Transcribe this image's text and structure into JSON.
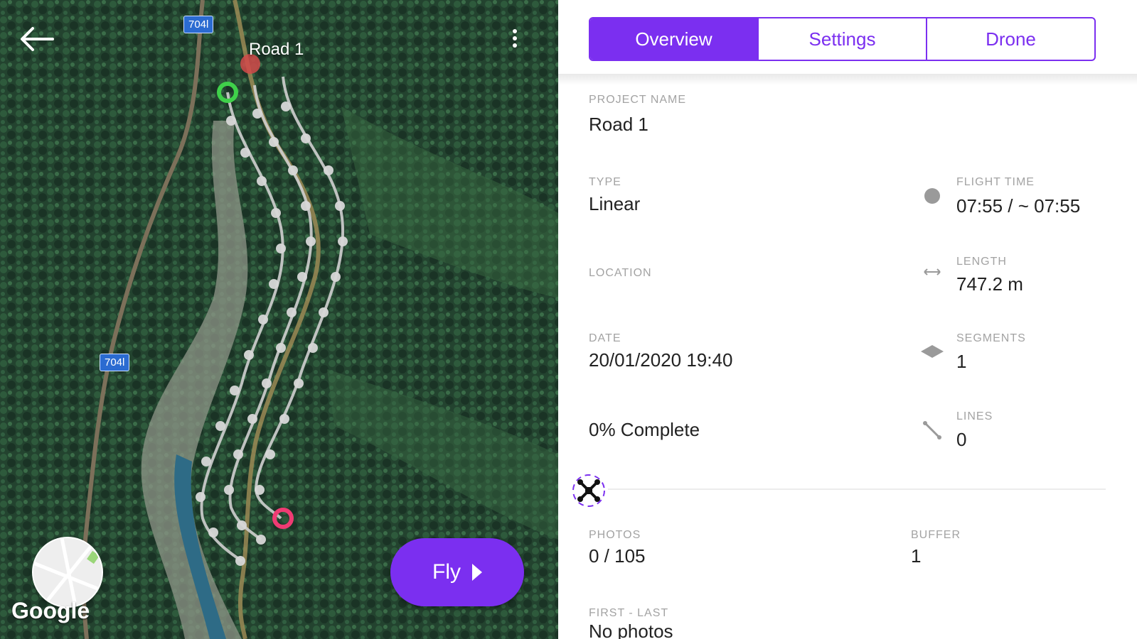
{
  "map": {
    "title": "Road 1",
    "road_shields": [
      "704l",
      "704l"
    ],
    "provider": "Google",
    "fly_button_label": "Fly"
  },
  "tabs": [
    {
      "label": "Overview",
      "active": true
    },
    {
      "label": "Settings",
      "active": false
    },
    {
      "label": "Drone",
      "active": false
    }
  ],
  "overview": {
    "project_name_label": "PROJECT NAME",
    "project_name": "Road 1",
    "type_label": "TYPE",
    "type": "Linear",
    "flight_time_label": "FLIGHT TIME",
    "flight_time": "07:55 / ~ 07:55",
    "location_label": "LOCATION",
    "length_label": "LENGTH",
    "length": "747.2 m",
    "date_label": "DATE",
    "date": "20/01/2020 19:40",
    "segments_label": "SEGMENTS",
    "segments": "1",
    "complete": "0% Complete",
    "lines_label": "LINES",
    "lines": "0",
    "photos_label": "PHOTOS",
    "photos": "0 / 105",
    "buffer_label": "BUFFER",
    "buffer": "1",
    "first_last_label": "FIRST - LAST",
    "first_last": "No photos"
  },
  "colors": {
    "accent": "#7b2ff0",
    "start_marker": "#3fd14a",
    "end_marker": "#ef3b73"
  }
}
